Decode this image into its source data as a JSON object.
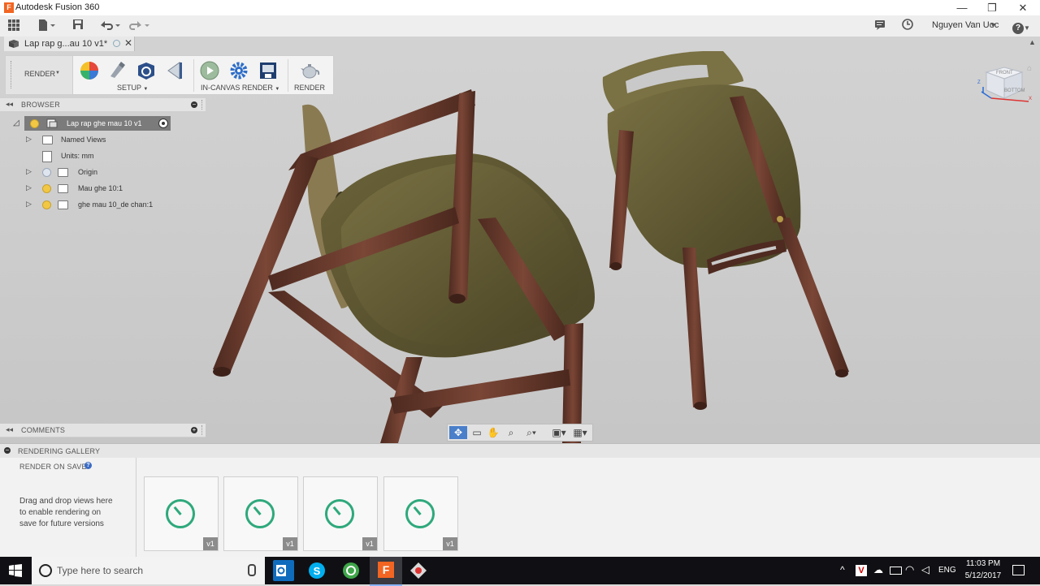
{
  "window": {
    "title": "Autodesk Fusion 360",
    "app_icon_letter": "F",
    "controls": [
      "—",
      "❐",
      "✕"
    ]
  },
  "qat": {
    "user": "Nguyen Van Uoc",
    "help": "?"
  },
  "doc_tab": {
    "label": "Lap rap g...au 10 v1*"
  },
  "ribbon": {
    "workspace": "RENDER",
    "setup_label": "SETUP",
    "incanvas_label": "IN-CANVAS RENDER",
    "render_label": "RENDER"
  },
  "browser": {
    "header": "BROWSER",
    "root": "Lap rap ghe mau 10 v1",
    "items": [
      {
        "label": "Named Views"
      },
      {
        "label": "Units: mm"
      },
      {
        "label": "Origin"
      },
      {
        "label": "Mau ghe 10:1"
      },
      {
        "label": "ghe mau 10_de chan:1"
      }
    ]
  },
  "comments": {
    "header": "COMMENTS"
  },
  "viewcube": {
    "face_front": "FRONT",
    "face_bottom": "BOTTOM",
    "axis_z": "Z",
    "axis_x": "X"
  },
  "gallery": {
    "header": "RENDERING GALLERY",
    "render_on_save": "RENDER ON SAVE",
    "help_glyph": "?",
    "drop_text_1": "Drag and drop views here",
    "drop_text_2": "to enable rendering on",
    "drop_text_3": "save for future versions",
    "thumbs": [
      {
        "version": "v1"
      },
      {
        "version": "v1"
      },
      {
        "version": "v1"
      },
      {
        "version": "v1"
      }
    ]
  },
  "taskbar": {
    "search_placeholder": "Type here to search",
    "lang": "ENG",
    "time": "11:03 PM",
    "date": "5/12/2017"
  },
  "colors": {
    "wood": "#6a3a2c",
    "seat": "#5c5530",
    "accent_green": "#2ea97c",
    "taskbar": "#101014"
  }
}
